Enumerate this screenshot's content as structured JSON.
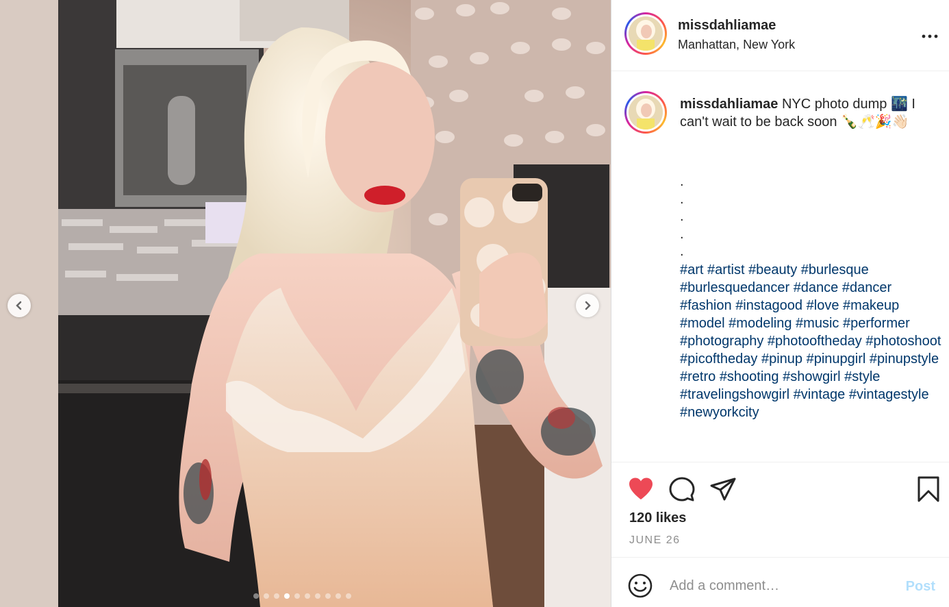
{
  "post": {
    "username": "missdahliamae",
    "location": "Manhattan, New York",
    "caption_text": " NYC photo dump 🌃 I can't wait to be back soon 🍾🥂🎉👋🏻",
    "caption_dots": [
      ".",
      ".",
      ".",
      ".",
      "."
    ],
    "hashtags": [
      "#art",
      "#artist",
      "#beauty",
      "#burlesque",
      "#burlesquedancer",
      "#dance",
      "#dancer",
      "#fashion",
      "#instagood",
      "#love",
      "#makeup",
      "#model",
      "#modeling",
      "#music",
      "#performer",
      "#photography",
      "#photooftheday",
      "#photoshoot",
      "#picoftheday",
      "#pinup",
      "#pinupgirl",
      "#pinupstyle",
      "#retro",
      "#shooting",
      "#showgirl",
      "#style",
      "#travelingshowgirl",
      "#vintage",
      "#vintagestyle",
      "#newyorkcity"
    ],
    "likes": "120 likes",
    "date": "JUNE 26"
  },
  "carousel": {
    "total": 10,
    "active_index": 3
  },
  "comment": {
    "placeholder": "Add a comment…",
    "post_label": "Post"
  },
  "icons": {
    "more": "more-options-icon",
    "like": "heart-filled-icon",
    "comment": "comment-bubble-icon",
    "share": "paper-plane-icon",
    "save": "bookmark-icon",
    "emoji": "smiley-icon",
    "prev": "chevron-left-icon",
    "next": "chevron-right-icon"
  },
  "colors": {
    "like": "#ed4956",
    "hashtag": "#00376b",
    "post_disabled": "#b2dffc",
    "muted": "#8e8e8e"
  }
}
